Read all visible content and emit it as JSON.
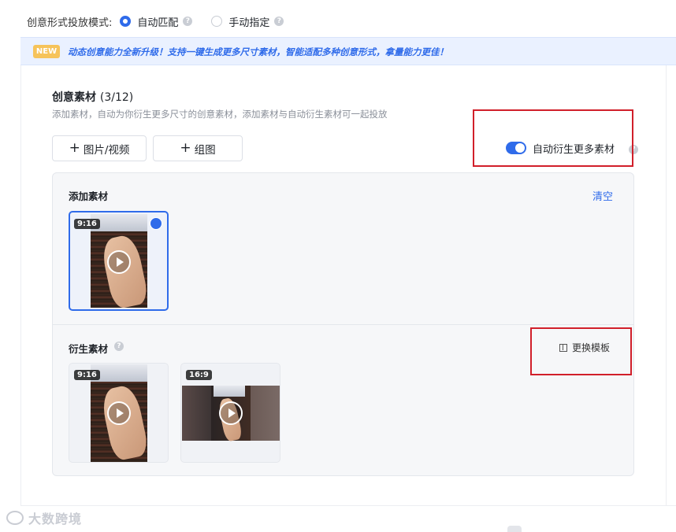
{
  "mode_row": {
    "label": "创意形式投放模式:",
    "options": [
      {
        "label": "自动匹配",
        "selected": true
      },
      {
        "label": "手动指定",
        "selected": false
      }
    ]
  },
  "banner": {
    "badge": "NEW",
    "text": "动态创意能力全新升级！支持一键生成更多尺寸素材，智能适配多种创意形式，拿量能力更佳！"
  },
  "creative": {
    "title": "创意素材",
    "count": "(3/12)",
    "description": "添加素材，自动为你衍生更多尺寸的创意素材，添加素材与自动衍生素材可一起投放",
    "buttons": {
      "image_video": "图片/视频",
      "group_image": "组图"
    },
    "auto_derive": {
      "label": "自动衍生更多素材",
      "enabled": true
    }
  },
  "added_materials": {
    "title": "添加素材",
    "clear": "清空",
    "items": [
      {
        "duration": "9:16",
        "selected": true
      }
    ]
  },
  "derived_materials": {
    "title": "衍生素材",
    "change_template": "更换模板",
    "items": [
      {
        "duration": "9:16"
      },
      {
        "duration": "16:9"
      }
    ]
  },
  "watermark": "大数跨境",
  "colors": {
    "accent": "#2f6bea",
    "highlight_box": "#d11f2a",
    "badge": "#f6c35a"
  }
}
